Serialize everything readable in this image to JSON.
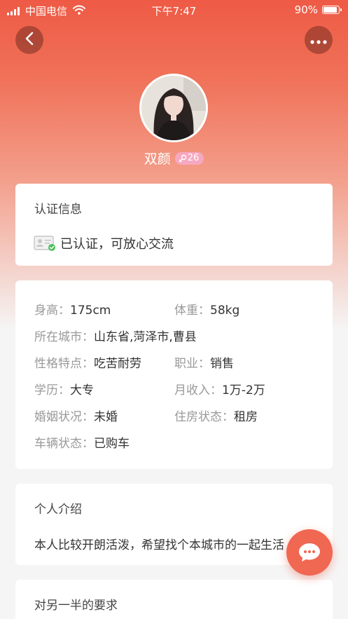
{
  "status_bar": {
    "carrier": "中国电信",
    "time": "下午7:47",
    "battery_percent": "90%",
    "battery_level": 0.9
  },
  "header": {
    "back_icon": "chevron-left-icon",
    "more_icon": "more-dots-icon"
  },
  "profile": {
    "name": "双颜",
    "age": "26",
    "gender_icon": "female-icon"
  },
  "certification": {
    "title": "认证信息",
    "status_text": "已认证，可放心交流",
    "icon": "id-card-verified-icon"
  },
  "details": {
    "height_label": "身高：",
    "height_value": "175cm",
    "weight_label": "体重：",
    "weight_value": "58kg",
    "city_label": "所在城市：",
    "city_value": "山东省,菏泽市,曹县",
    "personality_label": "性格特点：",
    "personality_value": "吃苦耐劳",
    "job_label": "职业：",
    "job_value": "销售",
    "education_label": "学历：",
    "education_value": "大专",
    "income_label": "月收入：",
    "income_value": "1万-2万",
    "marital_label": "婚姻状况：",
    "marital_value": "未婚",
    "housing_label": "住房状态：",
    "housing_value": "租房",
    "car_label": "车辆状态：",
    "car_value": "已购车"
  },
  "intro": {
    "title": "个人介绍",
    "text": "本人比较开朗活泼，希望找个本城市的一起生活"
  },
  "requirements": {
    "title": "对另一半的要求"
  },
  "chat_button": {
    "icon": "chat-bubble-icon"
  },
  "colors": {
    "accent": "#ee5a45",
    "badge_pink": "#f7a8c1",
    "label_gray": "#999999",
    "text_dark": "#333333"
  }
}
